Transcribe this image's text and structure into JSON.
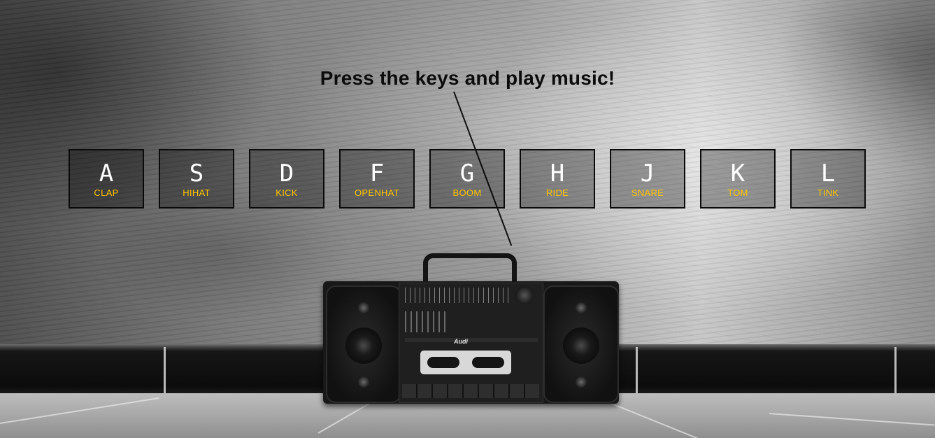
{
  "title": "Press the keys and play music!",
  "colors": {
    "letter": "#ffffff",
    "sound_label": "#ffc600",
    "key_border": "#0a0a0a",
    "title": "#0c0c0c"
  },
  "keys": [
    {
      "letter": "A",
      "sound": "CLAP"
    },
    {
      "letter": "S",
      "sound": "HIHAT"
    },
    {
      "letter": "D",
      "sound": "KICK"
    },
    {
      "letter": "F",
      "sound": "OPENHAT"
    },
    {
      "letter": "G",
      "sound": "BOOM"
    },
    {
      "letter": "H",
      "sound": "RIDE"
    },
    {
      "letter": "J",
      "sound": "SNARE"
    },
    {
      "letter": "K",
      "sound": "TOM"
    },
    {
      "letter": "L",
      "sound": "TINK"
    }
  ],
  "boombox_brand": "Audi"
}
